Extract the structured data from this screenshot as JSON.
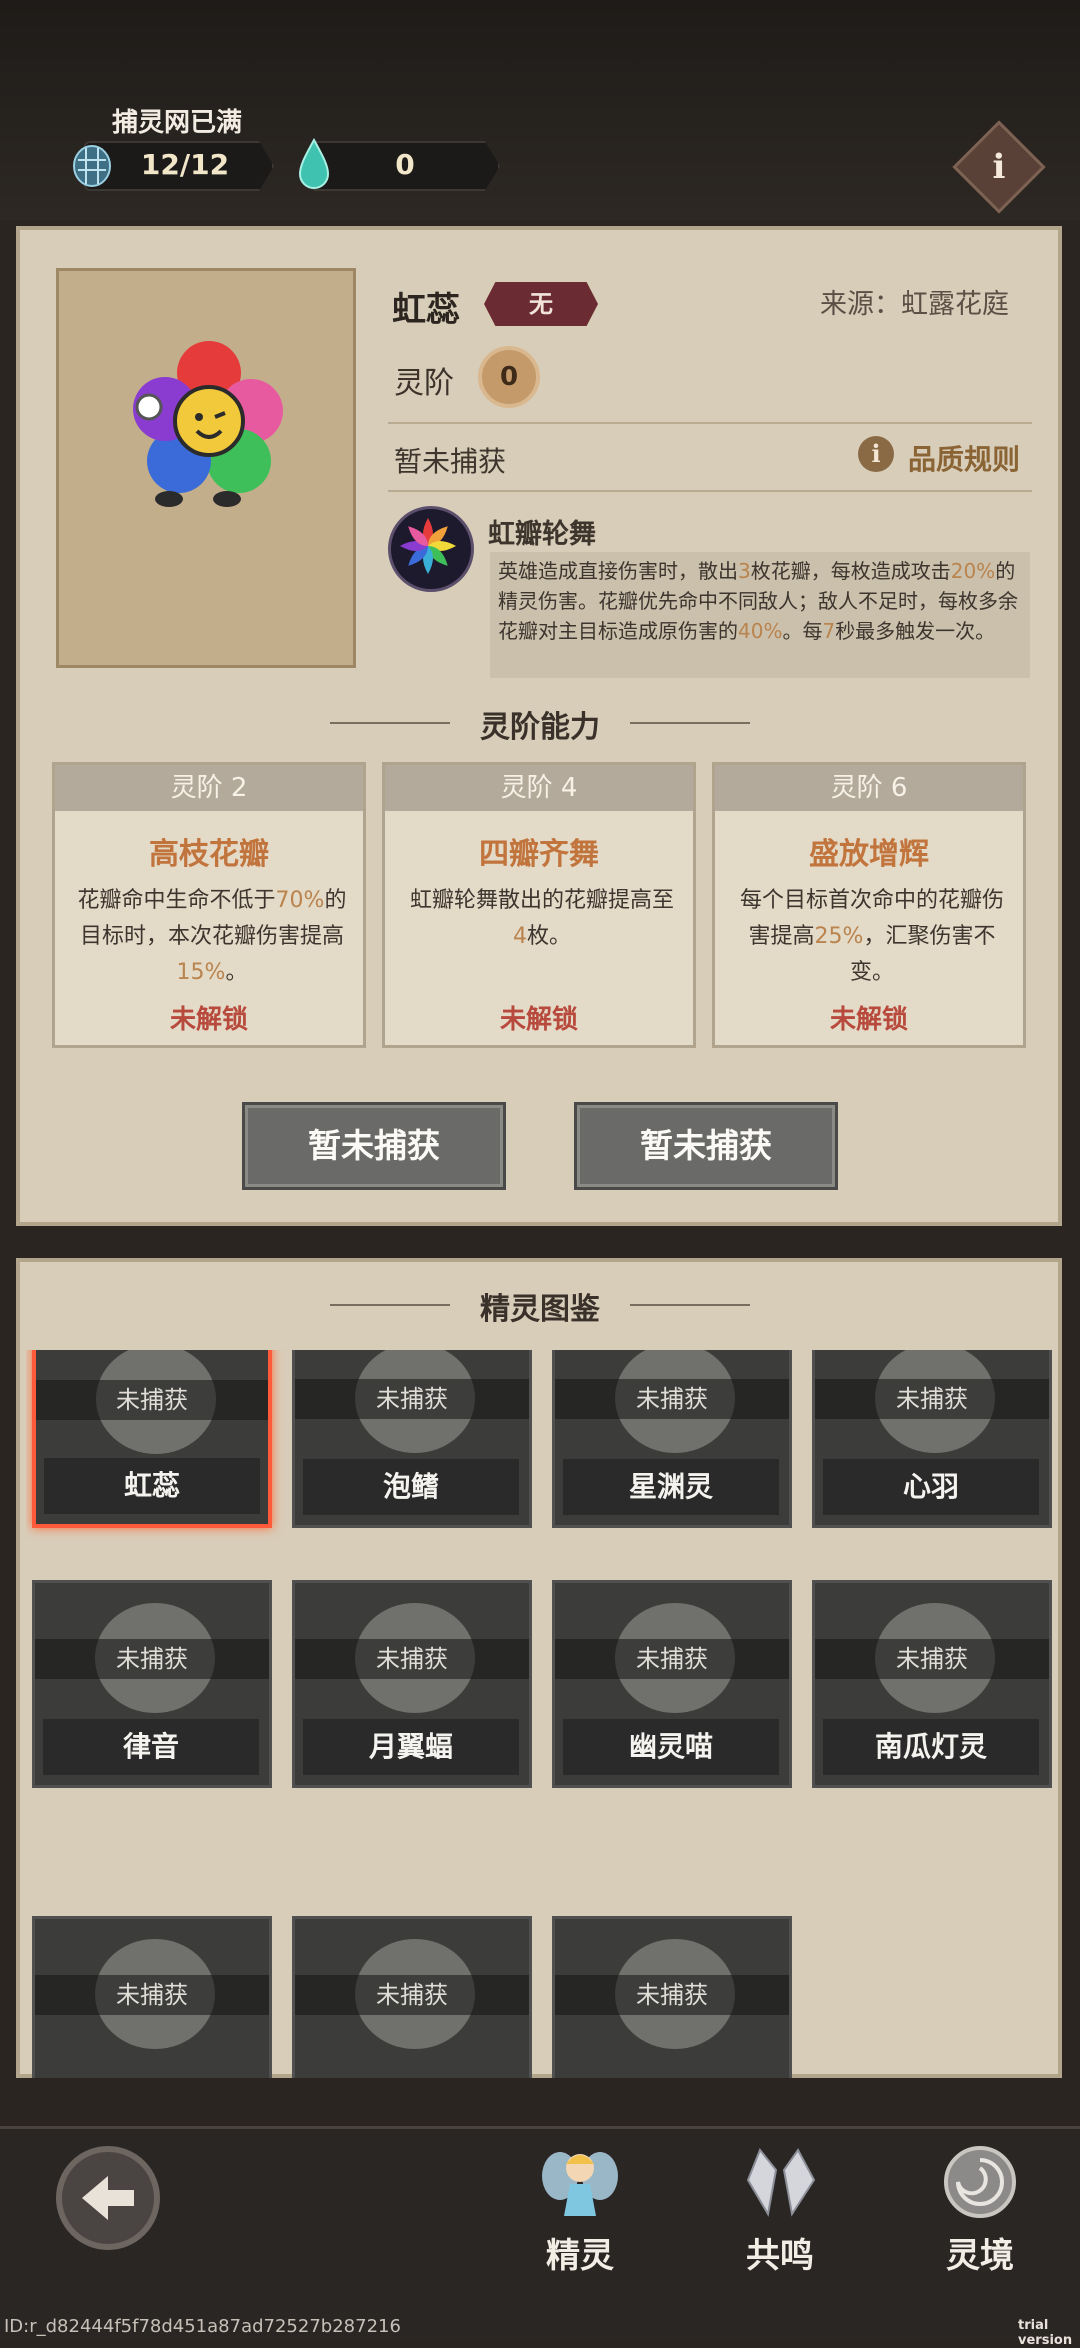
{
  "topbar": {
    "net_label": "捕灵网已满",
    "net_count": "12/12",
    "crystal_count": "0",
    "info_label": "i"
  },
  "spirit": {
    "name": "虹蕊",
    "quality": "无",
    "source": "来源：虹露花庭",
    "rank_label": "灵阶",
    "rank_value": "0",
    "status": "暂未捕获",
    "rule_icon": "i",
    "rule_label": "品质规则",
    "skill_name": "虹瓣轮舞",
    "skill_desc_parts": [
      "英雄造成直接伤害时，散出",
      "3",
      "枚花瓣，每枚造成攻击",
      "20%",
      "的精灵伤害。花瓣优先命中不同敌人；敌人不足时，每枚多余花瓣对主目标造成原伤害的",
      "40%",
      "。每",
      "7",
      "秒最多触发一次。"
    ]
  },
  "abilities": {
    "title": "灵阶能力",
    "cards": [
      {
        "head": "灵阶 2",
        "title": "高枝花瓣",
        "body_parts": [
          "花瓣命中生命不低于",
          "70%",
          "的目标时，本次花瓣伤害提高",
          "15%",
          "。"
        ],
        "lock": "未解锁"
      },
      {
        "head": "灵阶 4",
        "title": "四瓣齐舞",
        "body_parts": [
          "虹瓣轮舞散出的花瓣提高至",
          "4",
          "枚。",
          "",
          ""
        ],
        "lock": "未解锁"
      },
      {
        "head": "灵阶 6",
        "title": "盛放增辉",
        "body_parts": [
          "每个目标首次命中的花瓣伤害提高",
          "25%",
          "，汇聚伤害不变。",
          "",
          ""
        ],
        "lock": "未解锁"
      }
    ]
  },
  "buttons": {
    "left": "暂未捕获",
    "right": "暂未捕获"
  },
  "codex": {
    "title": "精灵图鉴",
    "uncaught_label": "未捕获",
    "spirits": [
      {
        "name": "虹蕊",
        "selected": true
      },
      {
        "name": "泡鳍"
      },
      {
        "name": "星渊灵"
      },
      {
        "name": "心羽"
      },
      {
        "name": "律音"
      },
      {
        "name": "月翼蝠"
      },
      {
        "name": "幽灵喵"
      },
      {
        "name": "南瓜灯灵"
      },
      {
        "name": ""
      },
      {
        "name": ""
      },
      {
        "name": ""
      }
    ]
  },
  "nav": {
    "back_icon": "back-arrow-icon",
    "tabs": [
      {
        "label": "精灵",
        "icon": "fairy-icon"
      },
      {
        "label": "共鸣",
        "icon": "crystal-icon"
      },
      {
        "label": "灵境",
        "icon": "portal-icon"
      }
    ]
  },
  "footer": {
    "id_text": "ID:r_d82444f5f78d451a87ad72527b287216",
    "trial_text": "trial version"
  },
  "colors": {
    "paper": "#d8cdb9",
    "highlight": "#b9844e",
    "lock_red": "#b84a3d",
    "card_title": "#c2743d",
    "quality_badge": "#6a2c32"
  }
}
